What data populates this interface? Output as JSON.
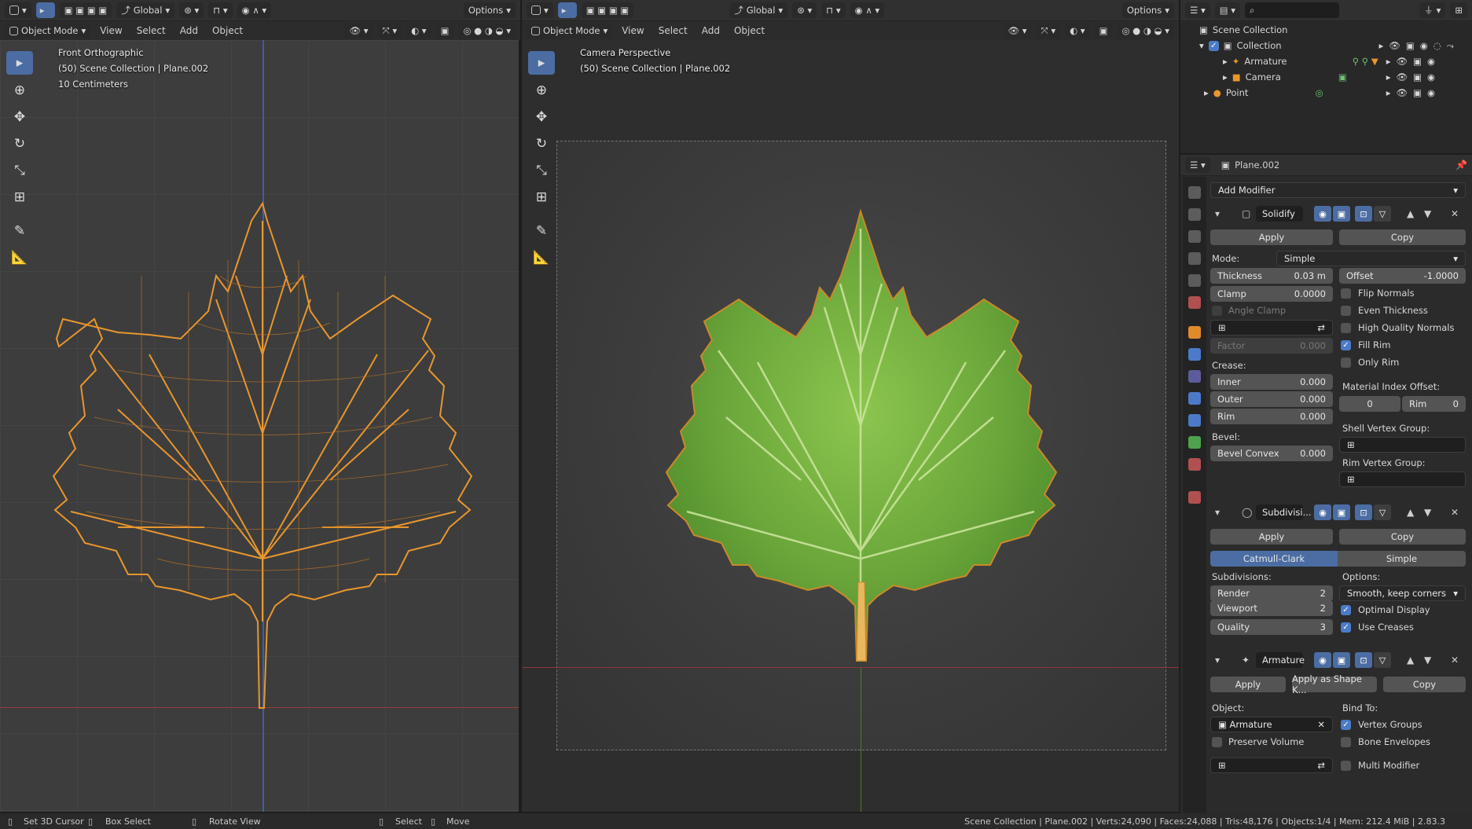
{
  "left_viewport": {
    "header": {
      "mode": "Object Mode",
      "menus": [
        "View",
        "Select",
        "Add",
        "Object"
      ],
      "orientation": "Global",
      "options": "Options"
    },
    "overlay": [
      "Front Orthographic",
      "(50) Scene Collection | Plane.002",
      "10 Centimeters"
    ]
  },
  "right_viewport": {
    "header": {
      "mode": "Object Mode",
      "menus": [
        "View",
        "Select",
        "Add",
        "Object"
      ],
      "orientation": "Global",
      "options": "Options"
    },
    "overlay": [
      "Camera Perspective",
      "(50) Scene Collection | Plane.002"
    ]
  },
  "tools": [
    "select-box",
    "cursor",
    "move",
    "rotate",
    "scale",
    "transform",
    "annotate",
    "measure"
  ],
  "outliner": {
    "search_placeholder": "",
    "root": "Scene Collection",
    "items": [
      {
        "name": "Collection",
        "icon": "collection-icon"
      },
      {
        "name": "Armature",
        "icon": "armature-icon"
      },
      {
        "name": "Camera",
        "icon": "camera-icon"
      },
      {
        "name": "Point",
        "icon": "light-icon"
      }
    ]
  },
  "properties": {
    "object_name": "Plane.002",
    "add_modifier": "Add Modifier",
    "solidify": {
      "name": "Solidify",
      "apply": "Apply",
      "copy": "Copy",
      "mode_label": "Mode:",
      "mode_value": "Simple",
      "thickness_label": "Thickness",
      "thickness_value": "0.03 m",
      "offset_label": "Offset",
      "offset_value": "-1.0000",
      "clamp_label": "Clamp",
      "clamp_value": "0.0000",
      "angle_clamp": "Angle Clamp",
      "factor_label": "Factor",
      "factor_value": "0.000",
      "crease_label": "Crease:",
      "inner_label": "Inner",
      "inner_value": "0.000",
      "outer_label": "Outer",
      "outer_value": "0.000",
      "rim_label": "Rim",
      "rim_value": "0.000",
      "bevel_label": "Bevel:",
      "bevel_convex_label": "Bevel Convex",
      "bevel_convex_value": "0.000",
      "flip_normals": "Flip Normals",
      "even_thickness": "Even Thickness",
      "high_quality_normals": "High Quality Normals",
      "fill_rim": "Fill Rim",
      "only_rim": "Only Rim",
      "material_index_offset": "Material Index Offset:",
      "mat_offset_value": "0",
      "mat_rim_label": "Rim",
      "mat_rim_value": "0",
      "shell_vertex_group": "Shell Vertex Group:",
      "rim_vertex_group": "Rim Vertex Group:"
    },
    "subdivision": {
      "name": "Subdivisi...",
      "apply": "Apply",
      "copy": "Copy",
      "catmull_clark": "Catmull-Clark",
      "simple": "Simple",
      "subdivisions_label": "Subdivisions:",
      "render_label": "Render",
      "render_value": "2",
      "viewport_label": "Viewport",
      "viewport_value": "2",
      "quality_label": "Quality",
      "quality_value": "3",
      "options_label": "Options:",
      "uv_smooth": "Smooth, keep corners",
      "optimal_display": "Optimal Display",
      "use_creases": "Use Creases"
    },
    "armature": {
      "name": "Armature",
      "apply": "Apply",
      "apply_shape": "Apply as Shape K...",
      "copy": "Copy",
      "object_label": "Object:",
      "object_value": "Armature",
      "preserve_volume": "Preserve Volume",
      "bind_to": "Bind To:",
      "vertex_groups": "Vertex Groups",
      "bone_envelopes": "Bone Envelopes",
      "multi_modifier": "Multi Modifier"
    }
  },
  "statusbar": {
    "set_cursor": "Set 3D Cursor",
    "box_select": "Box Select",
    "rotate_view": "Rotate View",
    "select": "Select",
    "move": "Move",
    "stats": "Scene Collection | Plane.002 | Verts:24,090 | Faces:24,088 | Tris:48,176 | Objects:1/4 | Mem: 212.4 MiB | 2.83.3"
  },
  "colors": {
    "accent": "#4b6da3",
    "wire": "#e8962e",
    "leaf": "#6fae3c"
  }
}
